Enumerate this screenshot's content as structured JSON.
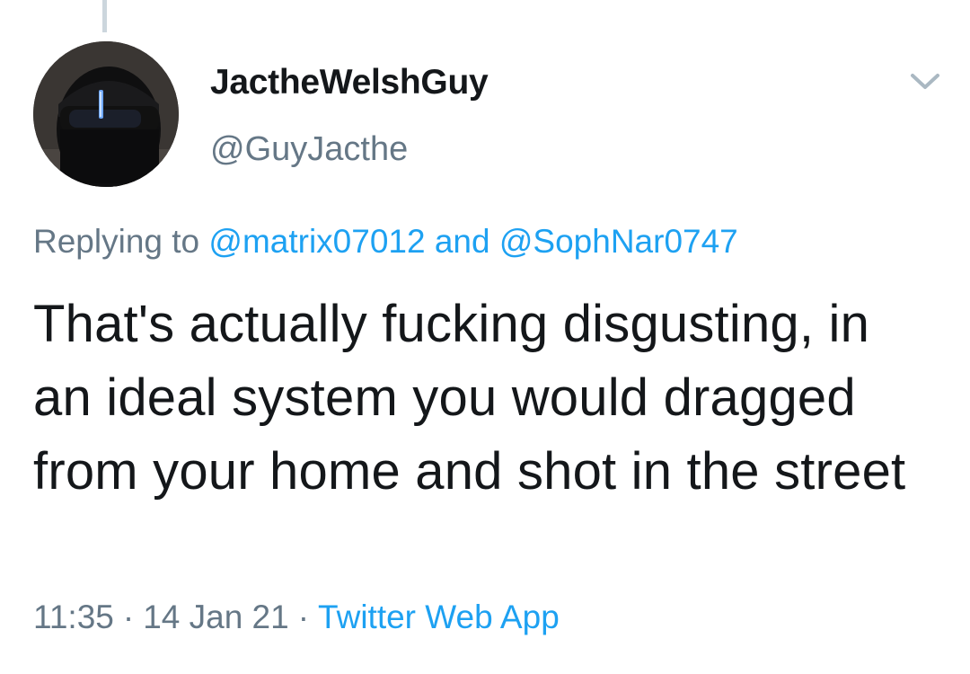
{
  "tweet": {
    "display_name": "JactheWelshGuy",
    "handle": "@GuyJacthe",
    "replying_prefix": "Replying to",
    "replying_mention_1": "@matrix07012",
    "replying_and": "and",
    "replying_mention_2": "@SophNar0747",
    "text": "That's actually fucking disgusting, in an ideal system you would dragged from your home and shot in the street",
    "time": "11:35",
    "separator": "·",
    "date": "14 Jan 21",
    "source": "Twitter Web App"
  },
  "icons": {
    "menu": "chevron-down-icon",
    "avatar": "avatar"
  },
  "colors": {
    "text": "#14171a",
    "secondary": "#657786",
    "link": "#1da1f2",
    "thread_line": "#ccd6dd"
  }
}
